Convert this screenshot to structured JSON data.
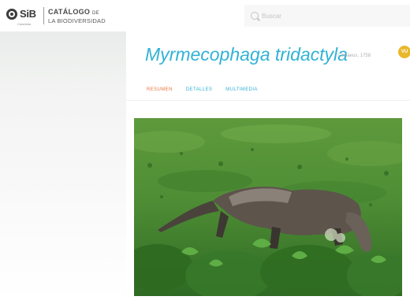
{
  "header": {
    "logo_text": "SiB",
    "logo_sub": "Colombia",
    "catalog_line1": "CATÁLOGO",
    "catalog_line1_small": "DE",
    "catalog_line2": "LA BIODIVERSIDAD"
  },
  "search": {
    "placeholder": "Buscar"
  },
  "species": {
    "scientific_name": "Myrmecophaga tridactyla",
    "author": "Linnaeus, 1758",
    "iucn_badge": "VU"
  },
  "tabs": [
    {
      "label": "Resumen",
      "active": true
    },
    {
      "label": "Detalles",
      "active": false
    },
    {
      "label": "Multimedia",
      "active": false
    }
  ],
  "colors": {
    "accent_blue": "#31b2d6",
    "active_tab": "#e8753a",
    "badge": "#e8b82b"
  }
}
